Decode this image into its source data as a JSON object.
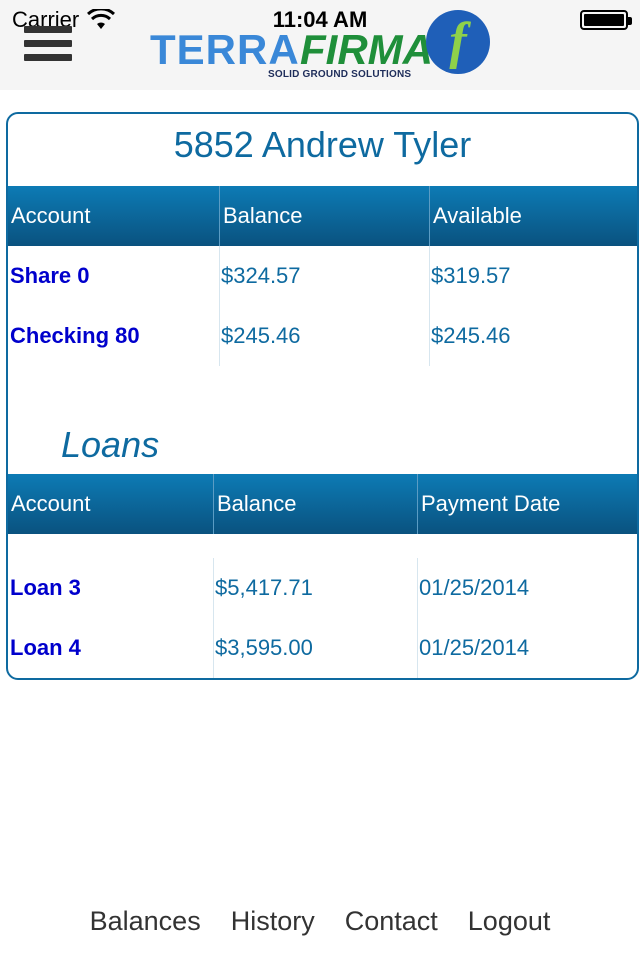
{
  "status_bar": {
    "carrier": "Carrier",
    "time": "11:04 AM"
  },
  "header": {
    "menu_icon": "hamburger-menu-icon",
    "logo": {
      "terra": "TERRA",
      "firma": "FIRMA",
      "mark": "f",
      "tagline": "SOLID GROUND SOLUTIONS"
    }
  },
  "member": {
    "title": "5852 Andrew Tyler"
  },
  "shares": {
    "columns": [
      "Account",
      "Balance",
      "Available"
    ],
    "rows": [
      {
        "account": "Share 0",
        "balance": "$324.57",
        "available": "$319.57"
      },
      {
        "account": "Checking 80",
        "balance": "$245.46",
        "available": "$245.46"
      }
    ]
  },
  "loans": {
    "heading": "Loans",
    "columns": [
      "Account",
      "Balance",
      "Payment Date"
    ],
    "rows": [
      {
        "account": "Loan 3",
        "balance": "$5,417.71",
        "payment_date": "01/25/2014"
      },
      {
        "account": "Loan 4",
        "balance": "$3,595.00",
        "payment_date": "01/25/2014"
      }
    ]
  },
  "bottom_nav": {
    "items": [
      "Balances",
      "History",
      "Contact",
      "Logout"
    ]
  },
  "colors": {
    "accent": "#0e6aa0",
    "link": "#0000cc",
    "header_gradient_top": "#0d7bb5",
    "header_gradient_bottom": "#0a527f"
  }
}
